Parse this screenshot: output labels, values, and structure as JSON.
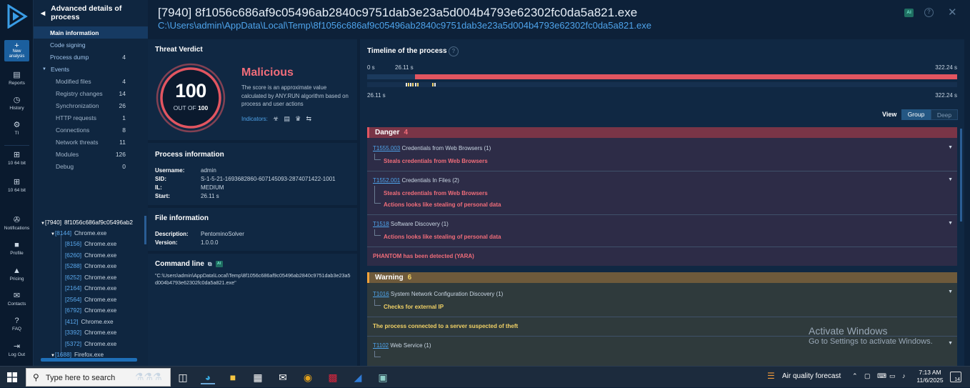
{
  "window": {
    "title": "[7940] 8f1056c686af9c05496ab2840c9751dab3e23a5d004b4793e62302fc0da5a821.exe",
    "path": "C:\\Users\\admin\\AppData\\Local\\Temp\\8f1056c686af9c05496ab2840c9751dab3e23a5d004b4793e62302fc0da5a821.exe",
    "ai_badge": "AI",
    "help_icon": "help-icon",
    "close_icon": "close-icon"
  },
  "rail": {
    "new_analysis": "New analysis",
    "items": [
      {
        "label": "Reports",
        "icon": "reports-icon"
      },
      {
        "label": "History",
        "icon": "history-icon"
      },
      {
        "label": "TI",
        "icon": "ti-icon"
      },
      {
        "label": "10 64 bit",
        "icon": "windows-icon"
      },
      {
        "label": "10 64 bit",
        "icon": "windows-icon"
      },
      {
        "label": "Notifications",
        "icon": "bell-icon"
      },
      {
        "label": "Profile",
        "icon": "profile-icon"
      },
      {
        "label": "Pricing",
        "icon": "cart-icon"
      },
      {
        "label": "Contacts",
        "icon": "mail-icon"
      },
      {
        "label": "FAQ",
        "icon": "question-icon"
      },
      {
        "label": "Log Out",
        "icon": "logout-icon"
      }
    ]
  },
  "nav": {
    "header": "Advanced details of process",
    "items": [
      {
        "label": "Main information",
        "count": ""
      },
      {
        "label": "Code signing",
        "count": ""
      },
      {
        "label": "Process dump",
        "count": "4"
      },
      {
        "label": "Events",
        "count": ""
      }
    ],
    "events": [
      {
        "label": "Modified files",
        "count": "4"
      },
      {
        "label": "Registry changes",
        "count": "14"
      },
      {
        "label": "Synchronization",
        "count": "26"
      },
      {
        "label": "HTTP requests",
        "count": "1"
      },
      {
        "label": "Connections",
        "count": "8"
      },
      {
        "label": "Network threats",
        "count": "11"
      },
      {
        "label": "Modules",
        "count": "126"
      },
      {
        "label": "Debug",
        "count": "0"
      }
    ]
  },
  "tree": {
    "root": {
      "pid": "[7940]",
      "name": "8f1056c686af9c05496ab2"
    },
    "chrome": {
      "pid": "[8144]",
      "name": "Chrome.exe"
    },
    "children": [
      {
        "pid": "[8156]",
        "name": "Chrome.exe"
      },
      {
        "pid": "[6260]",
        "name": "Chrome.exe"
      },
      {
        "pid": "[5288]",
        "name": "Chrome.exe"
      },
      {
        "pid": "[6252]",
        "name": "Chrome.exe"
      },
      {
        "pid": "[2164]",
        "name": "Chrome.exe"
      },
      {
        "pid": "[2564]",
        "name": "Chrome.exe"
      },
      {
        "pid": "[6792]",
        "name": "Chrome.exe"
      },
      {
        "pid": "[412]",
        "name": "Chrome.exe"
      },
      {
        "pid": "[3392]",
        "name": "Chrome.exe"
      },
      {
        "pid": "[5372]",
        "name": "Chrome.exe"
      }
    ],
    "firefox": {
      "pid": "[1688]",
      "name": "Firefox.exe"
    }
  },
  "verdict": {
    "title": "Threat Verdict",
    "score": "100",
    "out_of_prefix": "OUT OF",
    "out_of_value": "100",
    "label": "Malicious",
    "description": "The score is an approximate value calculated by ANY.RUN algorithm based on process and user actions",
    "indicators_label": "Indicators:",
    "indicator_icons": [
      "biohazard-icon",
      "document-icon",
      "spy-icon",
      "exchange-icon"
    ],
    "accent": "#e25560"
  },
  "process_info": {
    "title": "Process information",
    "rows": [
      {
        "k": "Username:",
        "v": "admin"
      },
      {
        "k": "SID:",
        "v": "S-1-5-21-1693682860-607145093-2874071422-1001"
      },
      {
        "k": "IL:",
        "v": "MEDIUM"
      },
      {
        "k": "Start:",
        "v": "26.11 s"
      }
    ]
  },
  "file_info": {
    "title": "File information",
    "rows": [
      {
        "k": "Description:",
        "v": "PentominoSolver"
      },
      {
        "k": "Version:",
        "v": "1.0.0.0"
      }
    ]
  },
  "command_line": {
    "title": "Command line",
    "ai_badge": "AI",
    "text": "\"C:\\Users\\admin\\AppData\\Local\\Temp\\8f1056c686af9c05496ab2840c9751dab3e23a5d004b4793e62302fc0da5a821.exe\""
  },
  "timeline": {
    "title": "Timeline of the process",
    "start": "0 s",
    "process_start": "26.11 s",
    "end": "322.24 s",
    "zoom_start": "26.11 s",
    "zoom_end": "322.24 s",
    "view_label": "View",
    "view_group": "Group",
    "view_deep": "Deep"
  },
  "danger": {
    "label": "Danger",
    "count": "4",
    "items": [
      {
        "id": "T1555.003",
        "name": "Credentials from Web Browsers (1)",
        "subs": [
          "Steals credentials from Web Browsers"
        ]
      },
      {
        "id": "T1552.001",
        "name": "Credentials In Files (2)",
        "subs": [
          "Steals credentials from Web Browsers",
          "Actions looks like stealing of personal data"
        ]
      },
      {
        "id": "T1518",
        "name": "Software Discovery (1)",
        "subs": [
          "Actions looks like stealing of personal data"
        ]
      }
    ],
    "plain": "PHANTOM has been detected (YARA)"
  },
  "warning": {
    "label": "Warning",
    "count": "6",
    "items": [
      {
        "id": "T1016",
        "name": "System Network Configuration Discovery (1)",
        "subs": [
          "Checks for external IP"
        ]
      },
      {
        "id": "T1102",
        "name": "Web Service (1)",
        "subs": []
      }
    ],
    "plain": "The process connected to a server suspected of theft"
  },
  "watermark": {
    "line1": "Activate Windows",
    "line2": "Go to Settings to activate Windows."
  },
  "taskbar": {
    "search_placeholder": "Type here to search",
    "weather": "Air quality forecast",
    "time": "7:13 AM",
    "date": "11/6/2025",
    "notifications": "14"
  }
}
